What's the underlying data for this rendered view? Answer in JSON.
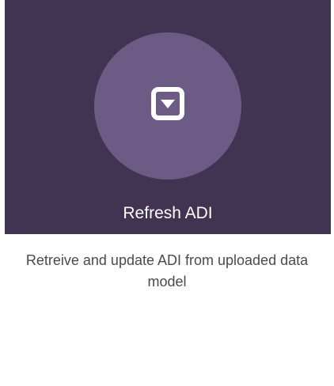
{
  "card": {
    "title": "Refresh ADI",
    "description": "Retreive and update ADI from uploaded data model",
    "icon": "dropdown-arrow-square-icon"
  },
  "colors": {
    "tile_background": "#413352",
    "circle_background": "#6c5b85",
    "title_text": "#ffffff",
    "description_text": "#4a4a4a"
  }
}
